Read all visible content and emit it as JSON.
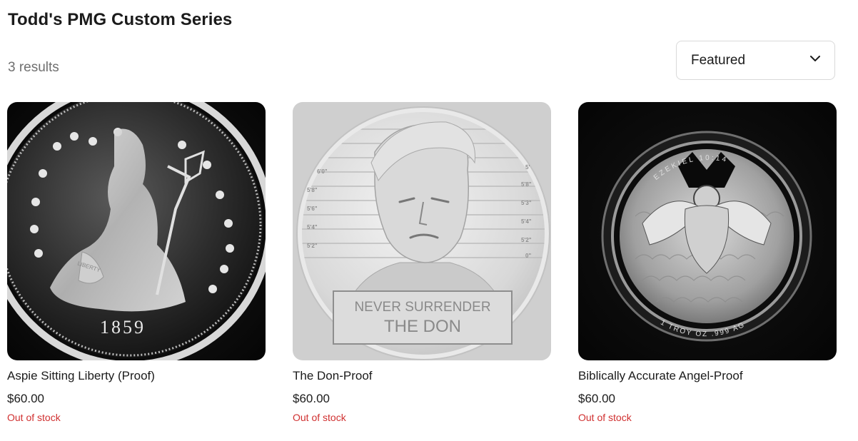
{
  "collection": {
    "title": "Todd's PMG Custom Series",
    "results": "3 results"
  },
  "sort": {
    "selected": "Featured",
    "icon": "chevron-down-icon"
  },
  "products": [
    {
      "name": "Aspie Sitting Liberty (Proof)",
      "price": "$60.00",
      "stock": "Out of stock",
      "coin": {
        "legend": "LIBERTY",
        "date": "1859"
      }
    },
    {
      "name": "The Don-Proof",
      "price": "$60.00",
      "stock": "Out of stock",
      "coin": {
        "line1": "NEVER SURRENDER",
        "line2": "THE DON",
        "heights_left": [
          "6'0\"",
          "5'8\"",
          "5'6\"",
          "5'4\"",
          "5'2\""
        ],
        "heights_right": [
          "5'",
          "5'8\"",
          "5'3\"",
          "5'4\"",
          "5'2\"",
          "0\""
        ]
      }
    },
    {
      "name": "Biblically Accurate Angel-Proof",
      "price": "$60.00",
      "stock": "Out of stock",
      "coin": {
        "top": "EZEKIEL 10:14",
        "bottom": "1 TROY OZ .999 AG"
      }
    }
  ],
  "colors": {
    "out_of_stock": "#d03030",
    "muted_text": "#6f6f6f"
  }
}
